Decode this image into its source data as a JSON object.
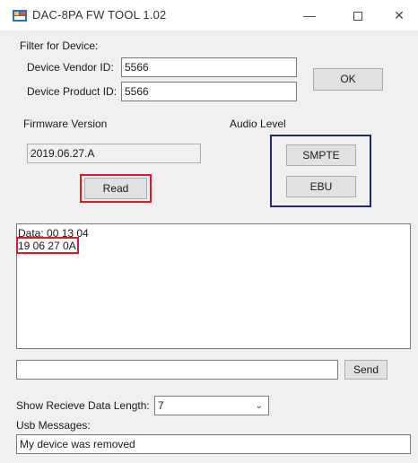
{
  "window": {
    "title": "DAC-8PA FW TOOL 1.02",
    "minimize_glyph": "—",
    "close_glyph": "✕"
  },
  "filter": {
    "heading": "Filter for Device:",
    "vendor_label": "Device Vendor ID:",
    "vendor_value": "5566",
    "product_label": "Device Product ID:",
    "product_value": "5566",
    "ok_label": "OK"
  },
  "firmware": {
    "heading": "Firmware Version",
    "version_value": "2019.06.27.A",
    "read_label": "Read"
  },
  "audio": {
    "heading": "Audio Level",
    "smpte_label": "SMPTE",
    "ebu_label": "EBU"
  },
  "data_box": {
    "line1": "Data: 00 13 04",
    "line2": "19 06 27 0A"
  },
  "send": {
    "input_value": "",
    "send_label": "Send"
  },
  "receive": {
    "length_label": "Show Recieve Data Length:",
    "length_value": "7"
  },
  "usb": {
    "label": "Usb Messages:",
    "message": "My device was removed"
  },
  "annotations": {
    "red_color": "#e0192a",
    "blue_color": "#1c2a6e"
  }
}
